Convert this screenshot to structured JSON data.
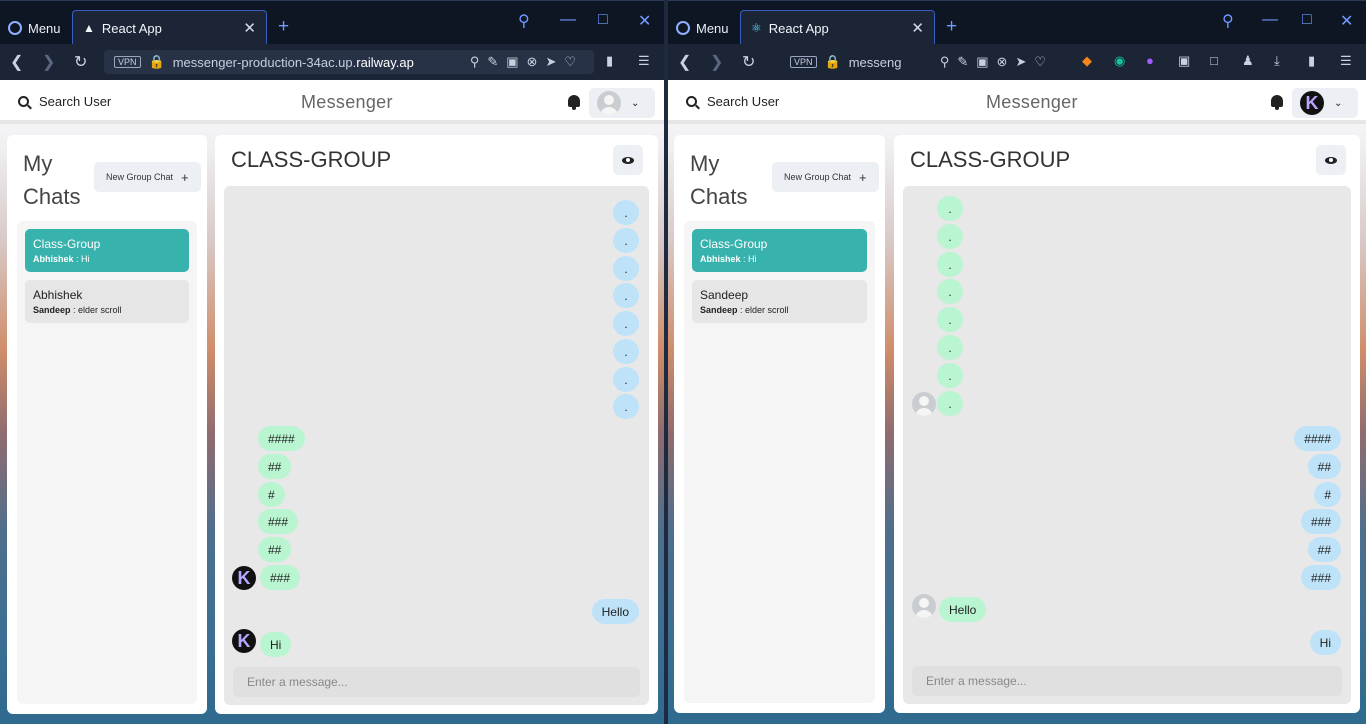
{
  "browser": {
    "menu_label": "Menu",
    "tab_title": "React App",
    "vpn_label": "VPN",
    "left_url_prefix": "messenger-production-34ac.up.",
    "left_url_domain": "railway.ap",
    "right_url": "messeng"
  },
  "app": {
    "search_label": "Search User",
    "brand": "Messenger",
    "my_chats_title": "My Chats",
    "new_group_label": "New Group Chat",
    "chat_title": "CLASS-GROUP",
    "input_placeholder": "Enter a message...",
    "avatar_letter": "K"
  },
  "left": {
    "chats": [
      {
        "name": "Class-Group",
        "sender": "Abhishek",
        "last": "Hi",
        "active": true
      },
      {
        "name": "Abhishek",
        "sender": "Sandeep",
        "last": "elder scroll",
        "active": false
      }
    ],
    "messages": [
      ".",
      ".",
      ".",
      ".",
      ".",
      ".",
      ".",
      ".",
      "####",
      "##",
      "#",
      "###",
      "##",
      "###",
      "Hello",
      "Hi"
    ]
  },
  "right": {
    "chats": [
      {
        "name": "Class-Group",
        "sender": "Abhishek",
        "last": "Hi",
        "active": true
      },
      {
        "name": "Sandeep",
        "sender": "Sandeep",
        "last": "elder scroll",
        "active": false
      }
    ],
    "messages": [
      ".",
      ".",
      ".",
      ".",
      ".",
      ".",
      ".",
      ".",
      "####",
      "##",
      "#",
      "###",
      "##",
      "###",
      "Hello",
      "Hi"
    ]
  }
}
